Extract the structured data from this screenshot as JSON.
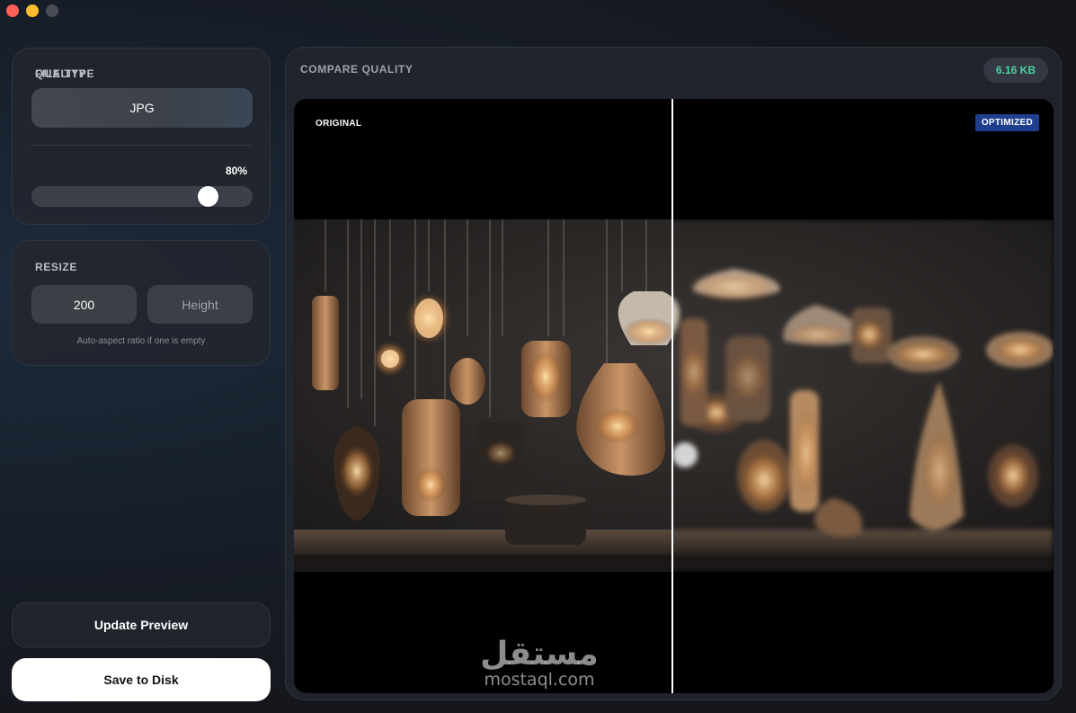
{
  "window": {
    "controls": [
      "close",
      "minimize",
      "zoom"
    ],
    "control_colors": {
      "close": "#fe5f57",
      "minimize": "#febc2e",
      "zoom": "#4a4d55"
    }
  },
  "sidebar": {
    "file_type": {
      "title": "FILE TYPE",
      "selected": "JPG"
    },
    "quality": {
      "title": "QUALITY",
      "value_label": "80%",
      "value": 0.8
    },
    "resize": {
      "title": "RESIZE",
      "width_value": "200",
      "height_placeholder": "Height",
      "hint": "Auto-aspect ratio if one is empty"
    },
    "update_label": "Update Preview",
    "save_label": "Save to Disk"
  },
  "compare": {
    "title": "COMPARE QUALITY",
    "file_size": "6.16 KB",
    "original_label": "ORIGINAL",
    "optimized_label": "OPTIMIZED",
    "split_position": 0.5,
    "accent_color": "#4fd1a0",
    "badge_color": "#1f3f8e"
  },
  "watermark": {
    "arabic": "مستقل",
    "latin": "mostaql.com"
  }
}
